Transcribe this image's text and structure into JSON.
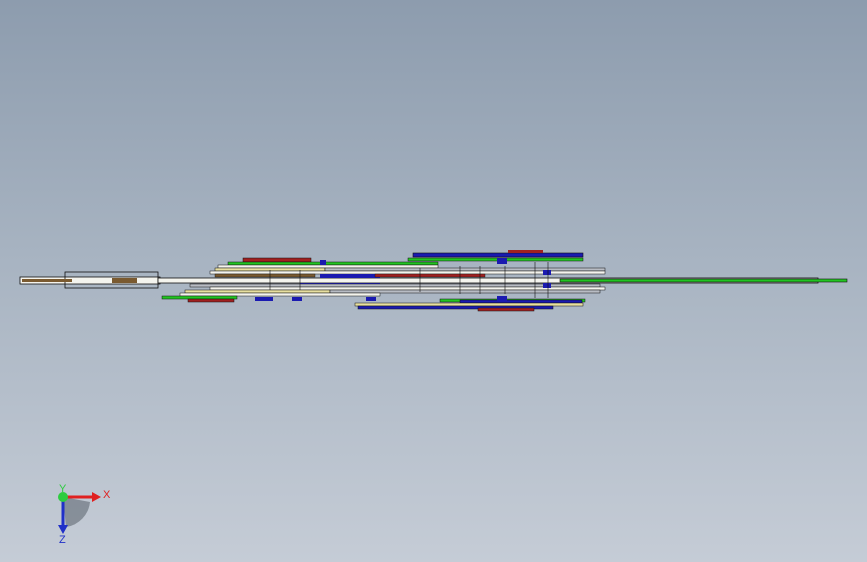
{
  "viewport": {
    "background_top": "#8d9cae",
    "background_bottom": "#c5ccd6",
    "model_name": "side-view-assembly"
  },
  "triad": {
    "x_label": "X",
    "y_label": "Y",
    "z_label": "Z",
    "x_color": "#e02020",
    "y_color": "#2ecc40",
    "z_color": "#2030c8"
  },
  "palette": {
    "white": "#f4f4ee",
    "black": "#101010",
    "blue": "#1a1ab0",
    "green": "#22c422",
    "red": "#a02020",
    "yellow": "#e8e0a0",
    "gray": "#b8bcc4",
    "brown": "#7a5a30"
  }
}
